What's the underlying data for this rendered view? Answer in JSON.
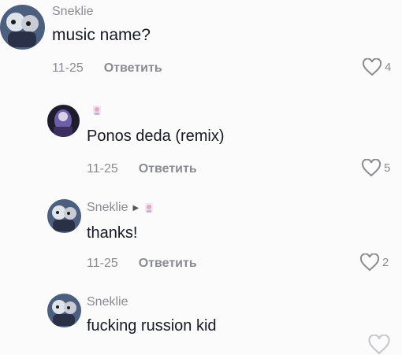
{
  "comments": [
    {
      "username": "Sneklie",
      "text": "music name?",
      "date": "11-25",
      "reply_label": "Ответить",
      "likes": "4"
    },
    {
      "username": "",
      "text": "Ponos deda (remix)",
      "date": "11-25",
      "reply_label": "Ответить",
      "likes": "5"
    },
    {
      "username": "Sneklie",
      "text": "thanks!",
      "date": "11-25",
      "reply_label": "Ответить",
      "likes": "2"
    },
    {
      "username": "Sneklie",
      "text": "fucking russion kid",
      "date": "",
      "reply_label": "",
      "likes": ""
    }
  ],
  "icons": {
    "like": "heart-outline-icon",
    "reply_arrow": "triangle-right-icon",
    "sticker": "sticker-icon"
  },
  "colors": {
    "meta_text": "#8a8b91",
    "body_text": "#161823",
    "background": "#fbfbfb"
  }
}
